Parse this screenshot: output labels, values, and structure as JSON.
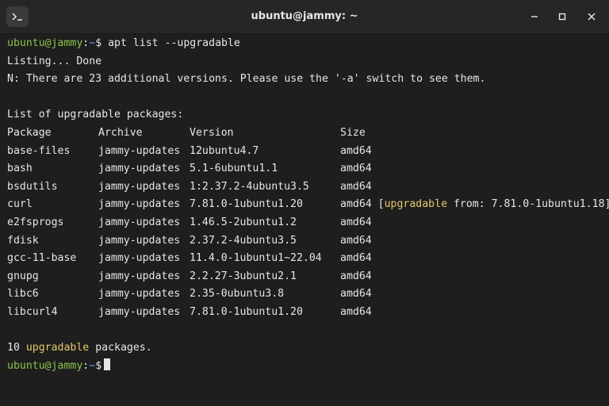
{
  "window": {
    "title": "ubuntu@jammy: ~",
    "icons": {
      "terminal": "terminal-icon",
      "minimize": "minimize-icon",
      "maximize": "maximize-icon",
      "close": "close-icon"
    }
  },
  "colors": {
    "background": "#1e1e1e",
    "titlebar": "#262626",
    "text": "#e6e6e6",
    "prompt_user": "#8ac24a",
    "prompt_path": "#63a0e4",
    "highlight": "#e6c96a"
  },
  "prompt": {
    "user_host": "ubuntu@jammy",
    "colon": ":",
    "path": "~",
    "symbol": "$"
  },
  "command": "apt list --upgradable",
  "output": {
    "listing": "Listing... Done",
    "notice": "N: There are 23 additional versions. Please use the '-a' switch to see them.",
    "list_header": "List of upgradable packages:",
    "columns": [
      "Package",
      "Archive",
      "Version",
      "Size"
    ],
    "rows": [
      {
        "package": "base-files",
        "archive": "jammy-updates",
        "version": "12ubuntu4.7",
        "size": "amd64"
      },
      {
        "package": "bash",
        "archive": "jammy-updates",
        "version": "5.1-6ubuntu1.1",
        "size": "amd64"
      },
      {
        "package": "bsdutils",
        "archive": "jammy-updates",
        "version": "1:2.37.2-4ubuntu3.5",
        "size": "amd64"
      },
      {
        "package": "curl",
        "archive": "jammy-updates",
        "version": "7.81.0-1ubuntu1.20",
        "size": "amd64",
        "note_open": "[",
        "note_highlight": "upgradable",
        "note_rest": " from: 7.81.0-1ubuntu1.18]"
      },
      {
        "package": "e2fsprogs",
        "archive": "jammy-updates",
        "version": "1.46.5-2ubuntu1.2",
        "size": "amd64"
      },
      {
        "package": "fdisk",
        "archive": "jammy-updates",
        "version": "2.37.2-4ubuntu3.5",
        "size": "amd64"
      },
      {
        "package": "gcc-11-base",
        "archive": "jammy-updates",
        "version": "11.4.0-1ubuntu1~22.04",
        "size": "amd64"
      },
      {
        "package": "gnupg",
        "archive": "jammy-updates",
        "version": "2.2.27-3ubuntu2.1",
        "size": "amd64"
      },
      {
        "package": "libc6",
        "archive": "jammy-updates",
        "version": "2.35-0ubuntu3.8",
        "size": "amd64"
      },
      {
        "package": "libcurl4",
        "archive": "jammy-updates",
        "version": "7.81.0-1ubuntu1.20",
        "size": "amd64"
      }
    ],
    "summary_count": "10",
    "summary_highlight": "upgradable",
    "summary_rest": "packages."
  }
}
